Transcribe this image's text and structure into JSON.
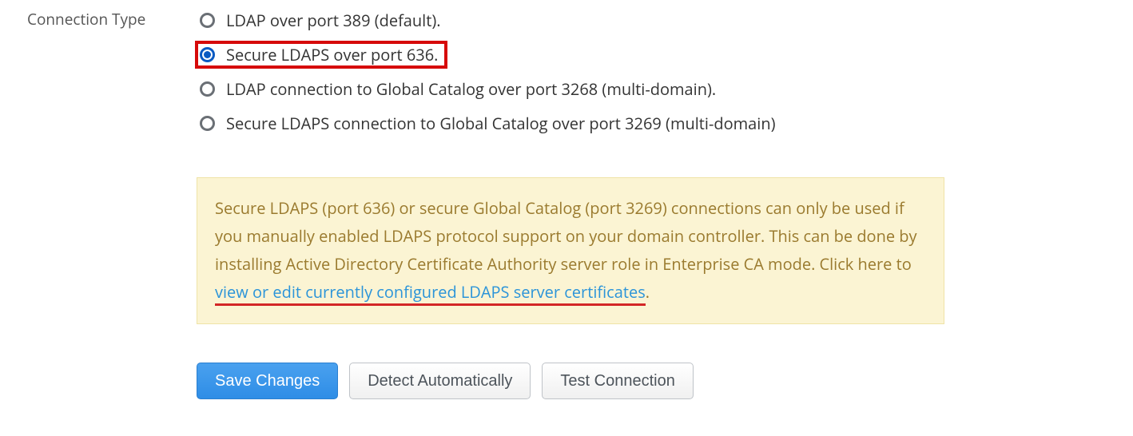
{
  "field": {
    "label": "Connection Type",
    "options": [
      {
        "label": "LDAP over port 389 (default).",
        "selected": false,
        "highlight": false
      },
      {
        "label": "Secure LDAPS over port 636.",
        "selected": true,
        "highlight": true
      },
      {
        "label": "LDAP connection to Global Catalog over port 3268 (multi-domain).",
        "selected": false,
        "highlight": false
      },
      {
        "label": "Secure LDAPS connection to Global Catalog over port 3269 (multi-domain)",
        "selected": false,
        "highlight": false
      }
    ]
  },
  "info": {
    "text_before_link": "Secure LDAPS (port 636) or secure Global Catalog (port 3269) connections can only be used if you manually enabled LDAPS protocol support on your domain controller. This can be done by installing Active Directory Certificate Authority server role in Enterprise CA mode. Click here to ",
    "link_text": "view or edit currently configured LDAPS server certificates",
    "text_after_link": "."
  },
  "buttons": {
    "save": "Save Changes",
    "detect": "Detect Automatically",
    "test": "Test Connection"
  }
}
